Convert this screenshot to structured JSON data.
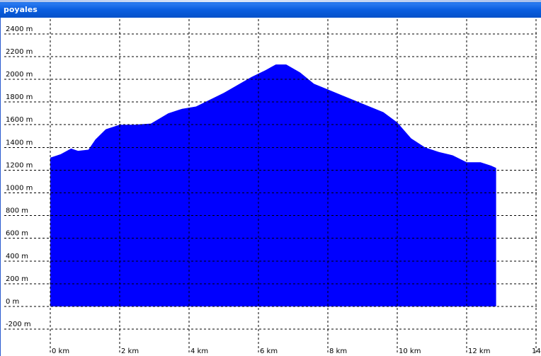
{
  "window": {
    "title": "poyales"
  },
  "colors": {
    "titlebar": "#0a5fd8",
    "area_fill": "#0000ff",
    "grid": "#000000",
    "background": "#ffffff"
  },
  "chart_data": {
    "type": "area",
    "title": "",
    "xlabel": "",
    "ylabel": "",
    "grid": true,
    "legend": "none",
    "xlim": [
      -0.1,
      14
    ],
    "ylim": [
      -250,
      2700
    ],
    "x_ticks": [
      {
        "value": 0,
        "label": "0 km"
      },
      {
        "value": 2,
        "label": "2 km"
      },
      {
        "value": 4,
        "label": "4 km"
      },
      {
        "value": 6,
        "label": "6 km"
      },
      {
        "value": 8,
        "label": "8 km"
      },
      {
        "value": 10,
        "label": "10 km"
      },
      {
        "value": 12,
        "label": "12 km"
      },
      {
        "value": 14,
        "label": "14"
      }
    ],
    "y_ticks": [
      {
        "value": 2400,
        "label": "2400 m"
      },
      {
        "value": 2200,
        "label": "2200 m"
      },
      {
        "value": 2000,
        "label": "2000 m"
      },
      {
        "value": 1800,
        "label": "1800 m"
      },
      {
        "value": 1600,
        "label": "1600 m"
      },
      {
        "value": 1400,
        "label": "1400 m"
      },
      {
        "value": 1200,
        "label": "1200 m"
      },
      {
        "value": 1000,
        "label": "1000 m"
      },
      {
        "value": 800,
        "label": "800 m"
      },
      {
        "value": 600,
        "label": "600 m"
      },
      {
        "value": 400,
        "label": "400 m"
      },
      {
        "value": 200,
        "label": "200 m"
      },
      {
        "value": 0,
        "label": "0 m"
      },
      {
        "value": -200,
        "label": "-200 m"
      }
    ],
    "series": [
      {
        "x": [
          0,
          0.3,
          0.6,
          0.8,
          1.1,
          1.3,
          1.6,
          2.0,
          2.4,
          2.9,
          3.4,
          3.8,
          4.2,
          4.6,
          5.0,
          5.4,
          5.8,
          6.2,
          6.5,
          6.8,
          7.2,
          7.6,
          8.0,
          8.4,
          8.8,
          9.2,
          9.6,
          10.0,
          10.4,
          10.8,
          11.2,
          11.6,
          12.0,
          12.4,
          12.7,
          12.85
        ],
        "values": [
          1310,
          1340,
          1390,
          1370,
          1380,
          1470,
          1560,
          1600,
          1600,
          1610,
          1700,
          1740,
          1760,
          1820,
          1880,
          1950,
          2020,
          2080,
          2130,
          2130,
          2060,
          1960,
          1910,
          1860,
          1810,
          1760,
          1710,
          1620,
          1480,
          1400,
          1360,
          1330,
          1270,
          1270,
          1240,
          1220
        ]
      }
    ]
  }
}
